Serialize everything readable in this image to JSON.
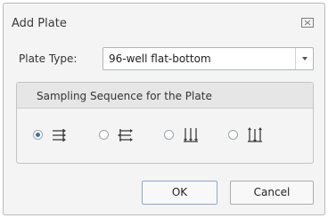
{
  "dialog": {
    "title": "Add Plate",
    "close_icon": "close-icon"
  },
  "plate_type": {
    "label": "Plate Type:",
    "selected": "96-well flat-bottom"
  },
  "sampling": {
    "title": "Sampling Sequence for the Plate",
    "options": [
      {
        "icon": "row-sequence-icon",
        "checked": true
      },
      {
        "icon": "row-serpentine-icon",
        "checked": false
      },
      {
        "icon": "column-sequence-icon",
        "checked": false
      },
      {
        "icon": "column-serpentine-icon",
        "checked": false
      }
    ]
  },
  "buttons": {
    "ok": "OK",
    "cancel": "Cancel"
  },
  "colors": {
    "radio_selected": "#3e6fa8",
    "icon": "#3d3d3d"
  }
}
